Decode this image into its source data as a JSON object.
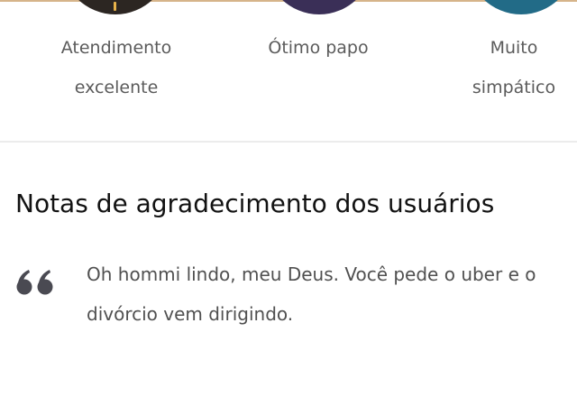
{
  "compliments": [
    {
      "label": "Atendimento\nexcelente",
      "color": "#2c2622"
    },
    {
      "label": "Ótimo papo",
      "color": "#3a2f57"
    },
    {
      "label": "Muito\nsimpático",
      "color": "#226b87"
    }
  ],
  "thank_you_notes": {
    "title": "Notas de agradecimento dos usuários",
    "icon": "quote-icon",
    "notes": [
      {
        "text": "Oh hommi lindo, meu Deus. Você pede o uber e o divórcio vem dirigindo."
      }
    ]
  }
}
